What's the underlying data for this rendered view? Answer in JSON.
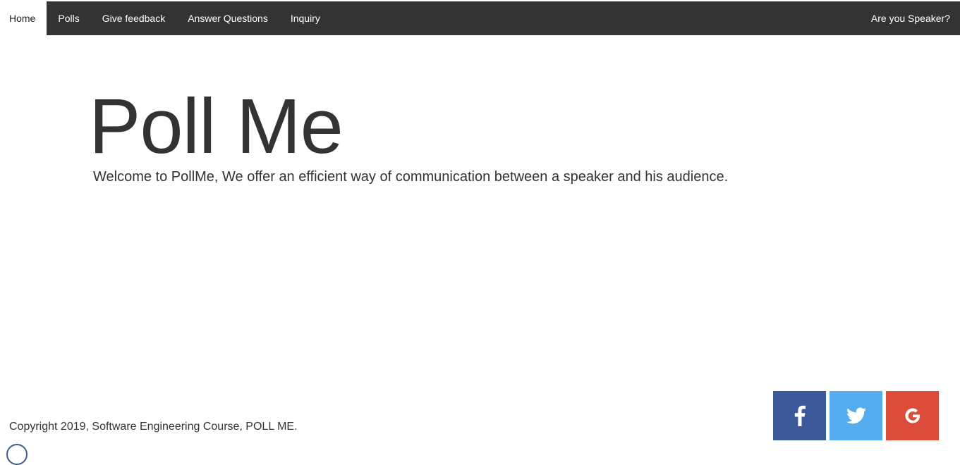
{
  "nav": {
    "items": [
      {
        "label": "Home",
        "active": true
      },
      {
        "label": "Polls"
      },
      {
        "label": "Give feedback"
      },
      {
        "label": "Answer Questions"
      },
      {
        "label": "Inquiry"
      }
    ],
    "right_label": "Are you Speaker?"
  },
  "hero": {
    "title": "Poll Me",
    "text": "Welcome to PollMe, We offer an efficient way of communication between a speaker and his audience."
  },
  "footer": {
    "copyright": "Copyright 2019, Software Engineering Course, POLL ME."
  },
  "social": {
    "buttons": [
      {
        "icon": "facebook-icon",
        "color": "#3b5998"
      },
      {
        "icon": "twitter-icon",
        "color": "#55acee"
      },
      {
        "icon": "google-icon",
        "color": "#dd4b39"
      }
    ]
  },
  "colors": {
    "navbar": "#333333",
    "nav_text": "#ffffff",
    "text": "#333333"
  }
}
